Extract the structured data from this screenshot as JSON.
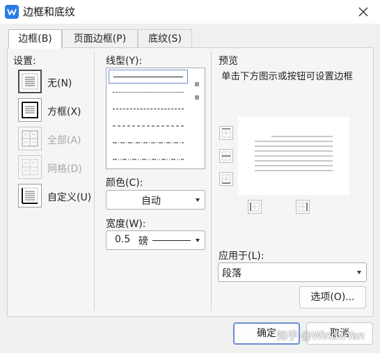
{
  "window": {
    "title": "边框和底纹",
    "app_icon": "wps-writer-icon"
  },
  "tabs": [
    {
      "label": "边框(B)",
      "active": true
    },
    {
      "label": "页面边框(P)",
      "active": false
    },
    {
      "label": "底纹(S)",
      "active": false
    }
  ],
  "setting": {
    "heading": "设置:",
    "items": [
      {
        "label": "无(N)",
        "enabled": true,
        "selected": true
      },
      {
        "label": "方框(X)",
        "enabled": true,
        "selected": false
      },
      {
        "label": "全部(A)",
        "enabled": false,
        "selected": false
      },
      {
        "label": "网格(D)",
        "enabled": false,
        "selected": false
      },
      {
        "label": "自定义(U)",
        "enabled": true,
        "selected": false
      }
    ]
  },
  "line_style": {
    "heading": "线型(Y):",
    "styles": [
      "solid",
      "dotted",
      "dashed-fine",
      "dashed",
      "dash-dot",
      "dash-dot-dot"
    ],
    "selected": "solid"
  },
  "color": {
    "heading": "颜色(C):",
    "value": "自动"
  },
  "width": {
    "heading": "宽度(W):",
    "value": "0.5",
    "unit": "磅"
  },
  "preview": {
    "heading": "预览",
    "hint": "单击下方图示或按钮可设置边框"
  },
  "apply_to": {
    "heading": "应用于(L):",
    "value": "段落"
  },
  "buttons": {
    "options": "选项(O)...",
    "ok": "确定",
    "cancel": "取消"
  },
  "watermark": "知乎 @WindwYan"
}
